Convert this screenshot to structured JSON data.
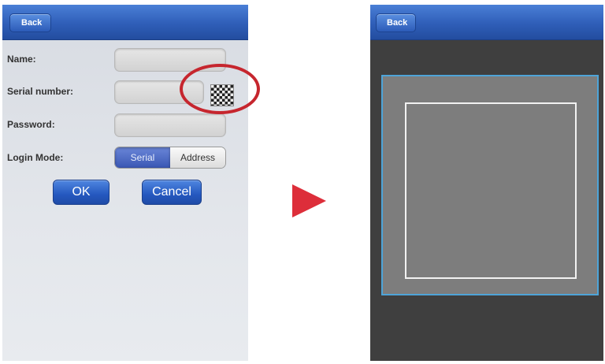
{
  "login_screen": {
    "back_label": "Back",
    "name_label": "Name:",
    "serial_label": "Serial number:",
    "password_label": "Password:",
    "login_mode_label": "Login Mode:",
    "mode_options": [
      "Serial",
      "Address"
    ],
    "selected_mode": "Serial",
    "ok_label": "OK",
    "cancel_label": "Cancel",
    "qr_icon": "qr-code-icon",
    "highlight_color": "#c6262e"
  },
  "arrow": {
    "icon": "arrow-right-icon",
    "color": "#dd2e3a"
  },
  "scanner_screen": {
    "back_label": "Back",
    "frame_color": "#4ea4d8"
  },
  "accent_color": "#2f5eb8"
}
